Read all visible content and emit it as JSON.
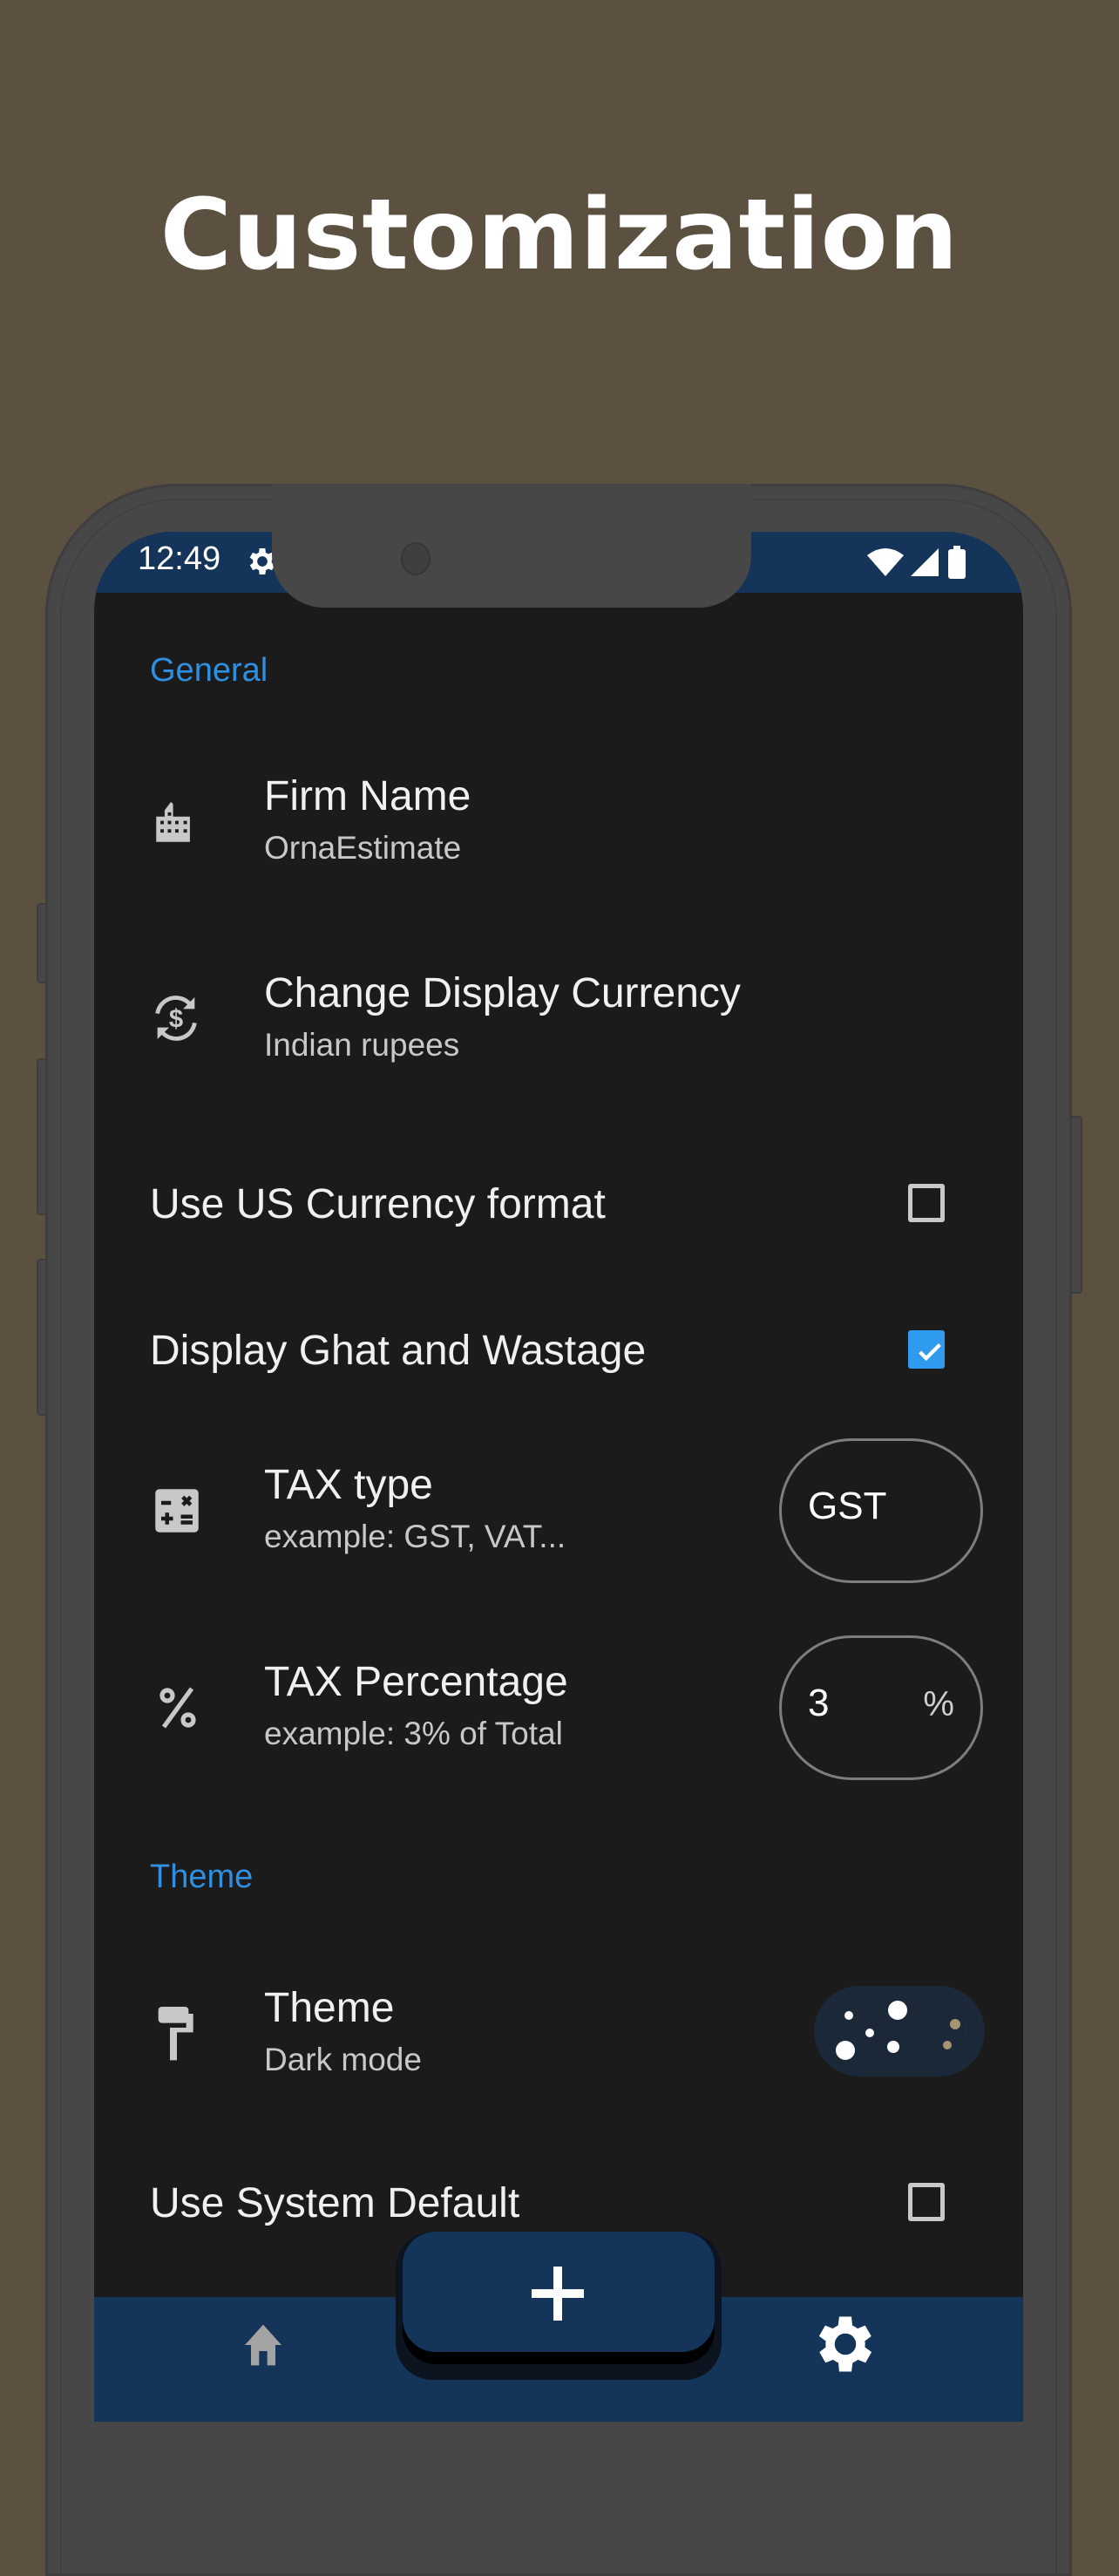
{
  "headline": "Customization",
  "status_bar": {
    "time": "12:49",
    "left_icons": [
      "gear-icon"
    ],
    "right_icons": [
      "wifi-icon",
      "signal-icon",
      "battery-icon"
    ]
  },
  "sections": {
    "general": {
      "header": "General",
      "firm_name": {
        "icon": "business-building-icon",
        "title": "Firm Name",
        "subtitle": "OrnaEstimate"
      },
      "display_currency": {
        "icon": "currency-exchange-icon",
        "title": "Change Display Currency",
        "subtitle": "Indian rupees"
      },
      "us_currency_format": {
        "label": "Use US Currency format",
        "checked": false
      },
      "ghat_wastage": {
        "label": "Display Ghat and Wastage",
        "checked": true
      },
      "tax_type": {
        "icon": "calculate-icon",
        "title": "TAX type",
        "subtitle": "example: GST, VAT...",
        "value": "GST"
      },
      "tax_percentage": {
        "icon": "percent-icon",
        "title": "TAX Percentage",
        "subtitle": "example: 3% of Total",
        "value": "3",
        "suffix": "%"
      }
    },
    "theme": {
      "header": "Theme",
      "theme_mode": {
        "icon": "format-paint-icon",
        "title": "Theme",
        "subtitle": "Dark mode",
        "toggle_state": "dark"
      },
      "system_default": {
        "label": "Use System Default",
        "checked": false
      }
    }
  },
  "bottom_nav": {
    "items": [
      {
        "icon": "home-icon",
        "active": false
      },
      {
        "icon": "add-icon",
        "label": "+"
      },
      {
        "icon": "settings-icon",
        "active": true
      }
    ]
  },
  "colors": {
    "background": "#5c5141",
    "screen": "#1b1b1b",
    "bar": "#14345a",
    "accent": "#2f9bef",
    "section_header": "#2f8fe0"
  }
}
